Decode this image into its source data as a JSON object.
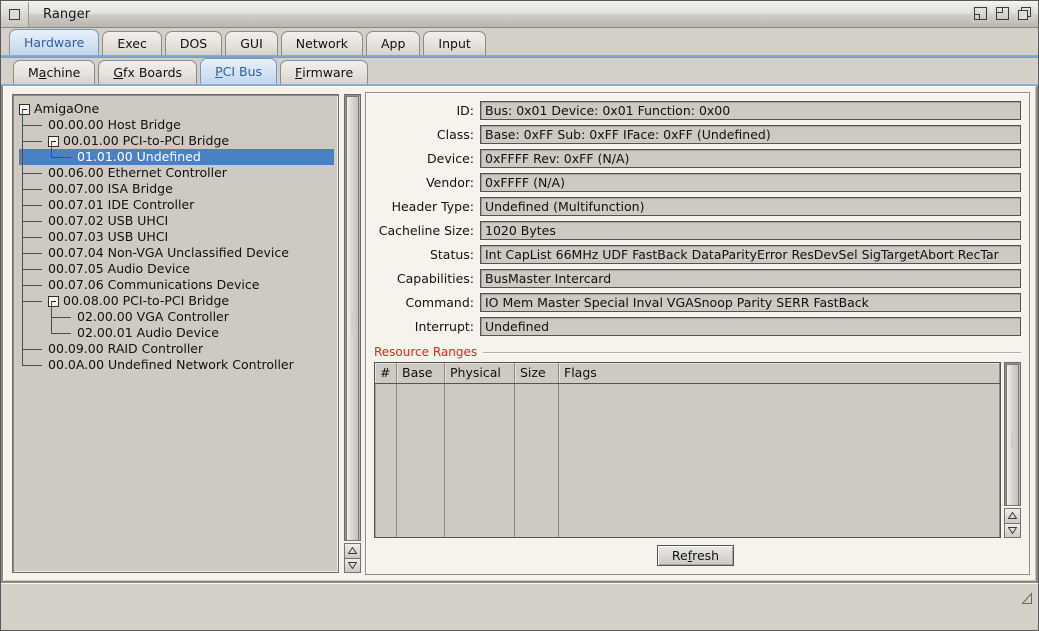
{
  "window": {
    "title": "Ranger",
    "close_gadget": "close-gadget",
    "gadgets": [
      "iconify-gadget",
      "zoom-gadget",
      "depth-gadget"
    ]
  },
  "tabs_primary": {
    "items": [
      {
        "label": "Hardware",
        "active": true
      },
      {
        "label": "Exec",
        "active": false
      },
      {
        "label": "DOS",
        "active": false
      },
      {
        "label": "GUI",
        "active": false
      },
      {
        "label": "Network",
        "active": false
      },
      {
        "label": "App",
        "active": false
      },
      {
        "label": "Input",
        "active": false
      }
    ]
  },
  "tabs_secondary": {
    "items": [
      {
        "label": "Machine",
        "accel": "a",
        "active": false
      },
      {
        "label": "Gfx Boards",
        "accel": "G",
        "active": false
      },
      {
        "label": "PCI Bus",
        "accel": "P",
        "active": true
      },
      {
        "label": "Firmware",
        "accel": "F",
        "active": false
      }
    ]
  },
  "tree": {
    "rows": [
      {
        "label": "AmigaOne",
        "depth": 0,
        "knob": "minus",
        "selected": false
      },
      {
        "label": "00.00.00 Host Bridge",
        "depth": 1,
        "knob": "none",
        "selected": false
      },
      {
        "label": "00.01.00 PCI-to-PCI Bridge",
        "depth": 1,
        "knob": "minus",
        "selected": false
      },
      {
        "label": "01.01.00 Undefined",
        "depth": 2,
        "knob": "none",
        "selected": true
      },
      {
        "label": "00.06.00 Ethernet Controller",
        "depth": 1,
        "knob": "none",
        "selected": false
      },
      {
        "label": "00.07.00 ISA Bridge",
        "depth": 1,
        "knob": "none",
        "selected": false
      },
      {
        "label": "00.07.01 IDE Controller",
        "depth": 1,
        "knob": "none",
        "selected": false
      },
      {
        "label": "00.07.02 USB UHCI",
        "depth": 1,
        "knob": "none",
        "selected": false
      },
      {
        "label": "00.07.03 USB UHCI",
        "depth": 1,
        "knob": "none",
        "selected": false
      },
      {
        "label": "00.07.04 Non-VGA Unclassified Device",
        "depth": 1,
        "knob": "none",
        "selected": false
      },
      {
        "label": "00.07.05 Audio Device",
        "depth": 1,
        "knob": "none",
        "selected": false
      },
      {
        "label": "00.07.06 Communications Device",
        "depth": 1,
        "knob": "none",
        "selected": false
      },
      {
        "label": "00.08.00 PCI-to-PCI Bridge",
        "depth": 1,
        "knob": "minus",
        "selected": false
      },
      {
        "label": "02.00.00 VGA Controller",
        "depth": 2,
        "knob": "none",
        "selected": false
      },
      {
        "label": "02.00.01 Audio Device",
        "depth": 2,
        "knob": "none",
        "selected": false
      },
      {
        "label": "00.09.00 RAID Controller",
        "depth": 1,
        "knob": "none",
        "selected": false
      },
      {
        "label": "00.0A.00 Undefined Network Controller",
        "depth": 1,
        "knob": "none",
        "selected": false
      }
    ]
  },
  "details": {
    "fields": [
      {
        "label": "ID:",
        "value": "Bus: 0x01 Device: 0x01 Function: 0x00"
      },
      {
        "label": "Class:",
        "value": "Base: 0xFF Sub: 0xFF IFace: 0xFF (Undefined)"
      },
      {
        "label": "Device:",
        "value": "0xFFFF Rev: 0xFF (N/A)"
      },
      {
        "label": "Vendor:",
        "value": "0xFFFF (N/A)"
      },
      {
        "label": "Header Type:",
        "value": "Undefined (Multifunction)"
      },
      {
        "label": "Cacheline Size:",
        "value": "1020 Bytes"
      },
      {
        "label": "Status:",
        "value": "Int CapList 66MHz UDF FastBack DataParityError ResDevSel SigTargetAbort RecTar"
      },
      {
        "label": "Capabilities:",
        "value": "BusMaster Intercard"
      },
      {
        "label": "Command:",
        "value": "IO Mem Master Special Inval VGASnoop Parity SERR FastBack"
      },
      {
        "label": "Interrupt:",
        "value": "Undefined"
      }
    ]
  },
  "resource_ranges": {
    "title": "Resource Ranges",
    "columns": [
      "#",
      "Base",
      "Physical",
      "Size",
      "Flags"
    ],
    "rows": []
  },
  "actions": {
    "refresh_pre": "Re",
    "refresh_accel": "f",
    "refresh_post": "resh"
  },
  "colors": {
    "accent_tab": "#2b5ea8",
    "selection": "#4a80c4",
    "group_title": "#cc2b20",
    "face": "#d4d0c8",
    "pane": "#f6f3ed",
    "field": "#cecac2"
  }
}
